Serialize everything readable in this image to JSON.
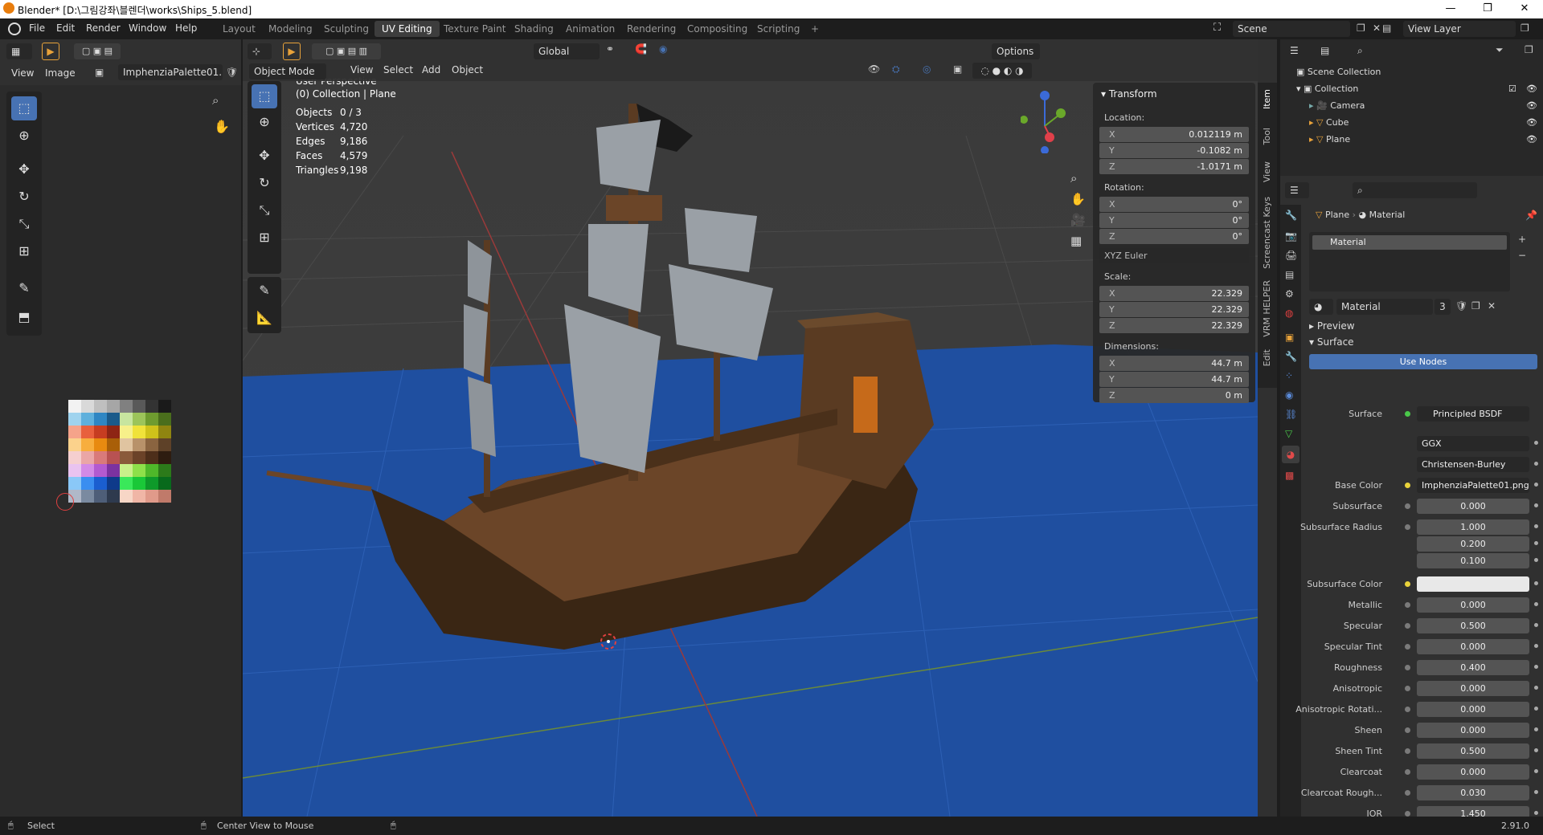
{
  "title": "Blender* [D:\\그림강좌\\블렌더\\works\\Ships_5.blend]",
  "window_buttons": [
    "—",
    "❐",
    "✕"
  ],
  "menu": [
    "File",
    "Edit",
    "Render",
    "Window",
    "Help"
  ],
  "workspaces": [
    "Layout",
    "Modeling",
    "Sculpting",
    "UV Editing",
    "Texture Paint",
    "Shading",
    "Animation",
    "Rendering",
    "Compositing",
    "Scripting",
    "+"
  ],
  "active_workspace": "UV Editing",
  "scene": "Scene",
  "view_layer": "View Layer",
  "uv_editor": {
    "menu": [
      "View",
      "Image"
    ],
    "image_name": "ImphenziaPalette01...",
    "palette_colors": [
      "#f2f2f2",
      "#d9d9d9",
      "#bfbfbf",
      "#a6a6a6",
      "#808080",
      "#595959",
      "#333333",
      "#1a1a1a",
      "#9fd3ee",
      "#5fb0dc",
      "#2f86c3",
      "#1a5a8a",
      "#c7e59f",
      "#9cc45a",
      "#6e9b2f",
      "#4a6e1c",
      "#f5a38a",
      "#e8603d",
      "#c63d21",
      "#8e2514",
      "#f7f08a",
      "#f0e23a",
      "#cfc21a",
      "#8f8510",
      "#fbd28c",
      "#f7ae3e",
      "#e88a10",
      "#a95f08",
      "#e0c4a0",
      "#b8926a",
      "#8a6440",
      "#5e4128",
      "#f5cfcf",
      "#eaa6a6",
      "#d97a7a",
      "#b85252",
      "#8a5a3a",
      "#6b4228",
      "#4d2e1a",
      "#2e1c10",
      "#e9c3f0",
      "#d38ae6",
      "#b35ad0",
      "#7c32a0",
      "#c9f08a",
      "#8ee04a",
      "#4fb82a",
      "#2c7a1a",
      "#8ac8f7",
      "#3a8ef0",
      "#1a5ed0",
      "#0e3a8a",
      "#3ae85a",
      "#1ac838",
      "#0e9a2a",
      "#086a1c",
      "#b0b8c8",
      "#7a8aa0",
      "#4e5e78",
      "#2e3a4e",
      "#f7d6c6",
      "#f0b6a6",
      "#e09a8a",
      "#c07a6a"
    ]
  },
  "viewport": {
    "mode": "Object Mode",
    "menu": [
      "View",
      "Select",
      "Add",
      "Object"
    ],
    "orientation": "Global",
    "options": "Options",
    "view_name": "User Perspective",
    "collection_info": "(0) Collection | Plane",
    "stats": [
      {
        "label": "Objects",
        "value": "0 / 3"
      },
      {
        "label": "Vertices",
        "value": "4,720"
      },
      {
        "label": "Edges",
        "value": "9,186"
      },
      {
        "label": "Faces",
        "value": "4,579"
      },
      {
        "label": "Triangles",
        "value": "9,198"
      }
    ]
  },
  "transform": {
    "header": "Transform",
    "location_label": "Location:",
    "location": [
      {
        "axis": "X",
        "value": "0.012119 m"
      },
      {
        "axis": "Y",
        "value": "-0.1082 m"
      },
      {
        "axis": "Z",
        "value": "-1.0171 m"
      }
    ],
    "rotation_label": "Rotation:",
    "rotation": [
      {
        "axis": "X",
        "value": "0°"
      },
      {
        "axis": "Y",
        "value": "0°"
      },
      {
        "axis": "Z",
        "value": "0°"
      }
    ],
    "rotation_mode": "XYZ Euler",
    "scale_label": "Scale:",
    "scale": [
      {
        "axis": "X",
        "value": "22.329"
      },
      {
        "axis": "Y",
        "value": "22.329"
      },
      {
        "axis": "Z",
        "value": "22.329"
      }
    ],
    "dimensions_label": "Dimensions:",
    "dimensions": [
      {
        "axis": "X",
        "value": "44.7 m"
      },
      {
        "axis": "Y",
        "value": "44.7 m"
      },
      {
        "axis": "Z",
        "value": "0 m"
      }
    ]
  },
  "side_tabs": [
    "Item",
    "Tool",
    "View",
    "Screencast Keys",
    "VRM HELPER",
    "Edit"
  ],
  "outliner": {
    "root": "Scene Collection",
    "collection": "Collection",
    "items": [
      "Camera",
      "Cube",
      "Plane"
    ]
  },
  "properties": {
    "breadcrumb_object": "Plane",
    "breadcrumb_material": "Material",
    "slot": "Material",
    "material_name": "Material",
    "users": "3",
    "preview": "Preview",
    "surface_section": "Surface",
    "use_nodes": "Use Nodes",
    "surface_label": "Surface",
    "surface_value": "Principled BSDF",
    "distribution": "GGX",
    "subsurface_method": "Christensen-Burley",
    "base_color_label": "Base Color",
    "base_color_value": "ImphenziaPalette01.png",
    "rows": [
      {
        "label": "Subsurface",
        "value": "0.000",
        "fill": 0
      },
      {
        "label": "Subsurface Radius",
        "value": "1.000",
        "fill": 0
      },
      {
        "label": "",
        "value": "0.200",
        "fill": 0
      },
      {
        "label": "",
        "value": "0.100",
        "fill": 0
      },
      {
        "label": "Subsurface Color",
        "value": "",
        "fill": 0,
        "color": "#e8e8e8"
      },
      {
        "label": "Metallic",
        "value": "0.000",
        "fill": 0
      },
      {
        "label": "Specular",
        "value": "0.500",
        "fill": 0.5
      },
      {
        "label": "Specular Tint",
        "value": "0.000",
        "fill": 0
      },
      {
        "label": "Roughness",
        "value": "0.400",
        "fill": 0.4
      },
      {
        "label": "Anisotropic",
        "value": "0.000",
        "fill": 0
      },
      {
        "label": "Anisotropic Rotati...",
        "value": "0.000",
        "fill": 0
      },
      {
        "label": "Sheen",
        "value": "0.000",
        "fill": 0
      },
      {
        "label": "Sheen Tint",
        "value": "0.500",
        "fill": 0.5
      },
      {
        "label": "Clearcoat",
        "value": "0.000",
        "fill": 0
      },
      {
        "label": "Clearcoat Rough...",
        "value": "0.030",
        "fill": 0.03
      },
      {
        "label": "IOR",
        "value": "1.450",
        "fill": 0
      }
    ]
  },
  "status": {
    "left": "Select",
    "middle": "Center View to Mouse",
    "version": "2.91.0"
  },
  "colors": {
    "accent": "#4772b3",
    "water": "#1f4fa0",
    "hull": "#5a3b22",
    "sail": "#9aa0a6"
  }
}
